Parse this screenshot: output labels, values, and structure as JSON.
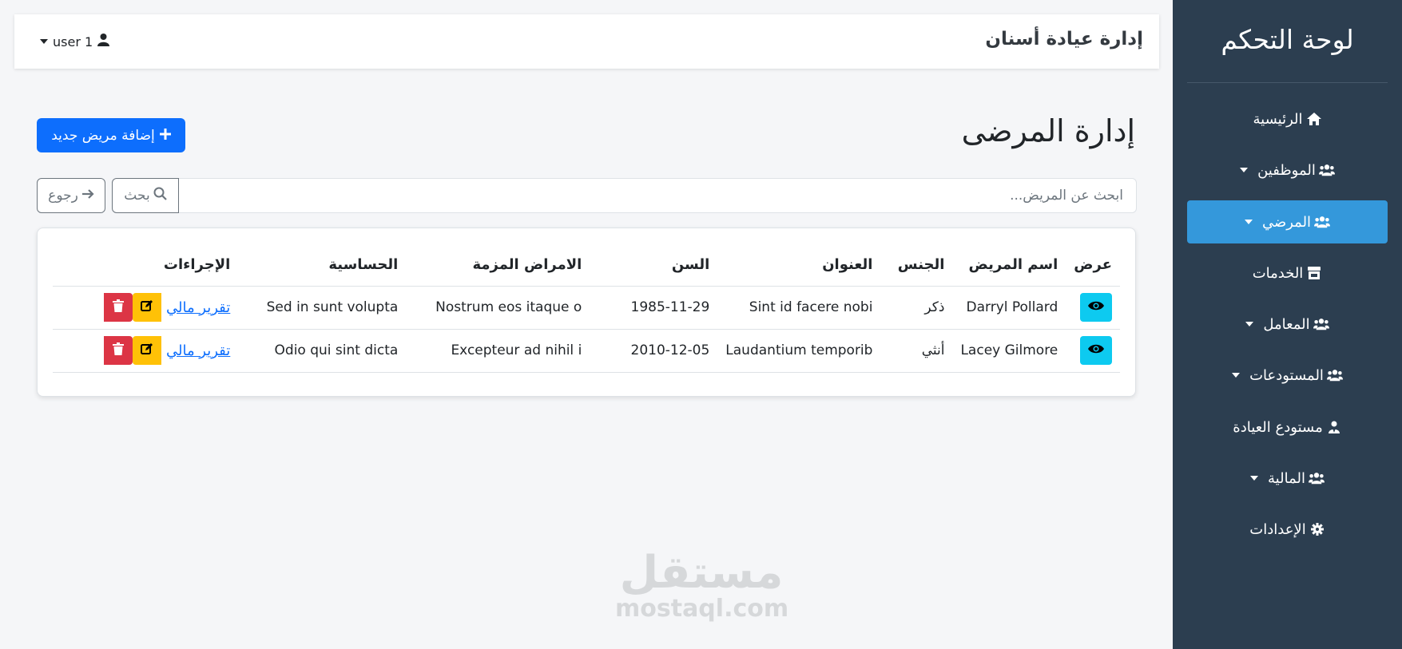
{
  "sidebar": {
    "title": "لوحة التحكم",
    "items": [
      {
        "label": "الرئيسية",
        "icon": "home-icon",
        "dropdown": false,
        "active": false
      },
      {
        "label": "الموظفين",
        "icon": "users-icon",
        "dropdown": true,
        "active": false
      },
      {
        "label": "المرضي",
        "icon": "users-icon",
        "dropdown": true,
        "active": true
      },
      {
        "label": "الخدمات",
        "icon": "store-icon",
        "dropdown": false,
        "active": false
      },
      {
        "label": "المعامل",
        "icon": "users-icon",
        "dropdown": true,
        "active": false
      },
      {
        "label": "المستودعات",
        "icon": "users-icon",
        "dropdown": true,
        "active": false
      },
      {
        "label": "مستودع العيادة",
        "icon": "user-tie-icon",
        "dropdown": false,
        "active": false
      },
      {
        "label": "المالية",
        "icon": "users-icon",
        "dropdown": true,
        "active": false
      },
      {
        "label": "الإعدادات",
        "icon": "gear-icon",
        "dropdown": false,
        "active": false
      }
    ]
  },
  "topbar": {
    "title": "إدارة عيادة أسنان",
    "user": "user 1"
  },
  "main": {
    "page_title": "إدارة المرضى",
    "add_button": "إضافة مريض جديد",
    "search_placeholder": "ابحث عن المريض...",
    "search_button": "بحث",
    "back_button": "رجوع"
  },
  "table": {
    "headers": [
      "عرض",
      "اسم المريض",
      "الجنس",
      "العنوان",
      "السن",
      "الامراض المزمة",
      "الحساسية",
      "الإجراءات"
    ],
    "rows": [
      {
        "name": "Darryl Pollard",
        "gender": "ذكر",
        "address": "Sint id facere nobi",
        "age": "1985-11-29",
        "chronic": "Nostrum eos itaque o",
        "allergy": "Sed in sunt volupta",
        "report": "تقرير مالي"
      },
      {
        "name": "Lacey Gilmore",
        "gender": "أنثي",
        "address": "Laudantium temporib",
        "age": "2010-12-05",
        "chronic": "Excepteur ad nihil i",
        "allergy": "Odio qui sint dicta",
        "report": "تقرير مالي"
      }
    ]
  },
  "watermark": {
    "arabic": "مستقل",
    "latin": "mostaql.com"
  },
  "colors": {
    "sidebar": "#2c3e50",
    "active": "#3498db",
    "primary": "#0d6efd",
    "info": "#0dcaf0",
    "warning": "#ffc107",
    "danger": "#dc3545"
  }
}
